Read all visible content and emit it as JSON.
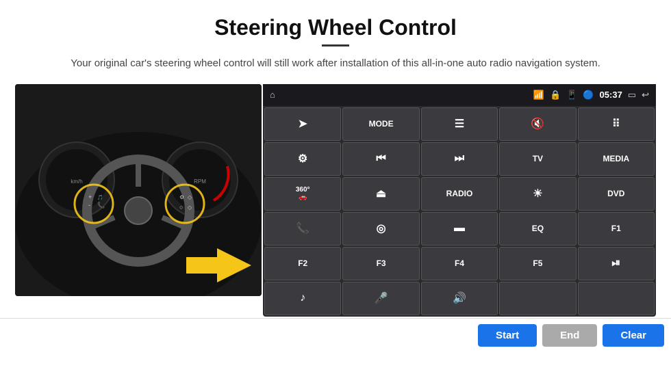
{
  "header": {
    "title": "Steering Wheel Control",
    "subtitle": "Your original car's steering wheel control will still work after installation of this all-in-one auto radio navigation system."
  },
  "status_bar": {
    "time": "05:37",
    "icons": [
      "wifi",
      "lock",
      "sim",
      "bluetooth",
      "screen",
      "back"
    ]
  },
  "grid": {
    "rows": [
      [
        {
          "label": "⌂",
          "type": "icon"
        },
        {
          "label": "MODE",
          "type": "text"
        },
        {
          "label": "≡",
          "type": "icon"
        },
        {
          "label": "🔇",
          "type": "icon"
        },
        {
          "label": "⠿",
          "type": "icon"
        }
      ],
      [
        {
          "label": "⊙",
          "type": "icon"
        },
        {
          "label": "⏮",
          "type": "icon"
        },
        {
          "label": "⏭",
          "type": "icon"
        },
        {
          "label": "TV",
          "type": "text"
        },
        {
          "label": "MEDIA",
          "type": "text"
        }
      ],
      [
        {
          "label": "360°",
          "type": "text"
        },
        {
          "label": "▲",
          "type": "icon"
        },
        {
          "label": "RADIO",
          "type": "text"
        },
        {
          "label": "☀",
          "type": "icon"
        },
        {
          "label": "DVD",
          "type": "text"
        }
      ],
      [
        {
          "label": "📞",
          "type": "icon"
        },
        {
          "label": "◉",
          "type": "icon"
        },
        {
          "label": "▬",
          "type": "icon"
        },
        {
          "label": "EQ",
          "type": "text"
        },
        {
          "label": "F1",
          "type": "text"
        }
      ],
      [
        {
          "label": "F2",
          "type": "text"
        },
        {
          "label": "F3",
          "type": "text"
        },
        {
          "label": "F4",
          "type": "text"
        },
        {
          "label": "F5",
          "type": "text"
        },
        {
          "label": "⏯",
          "type": "icon"
        }
      ],
      [
        {
          "label": "♪",
          "type": "icon"
        },
        {
          "label": "🎤",
          "type": "icon"
        },
        {
          "label": "🔊",
          "type": "icon"
        },
        {
          "label": "",
          "type": ""
        },
        {
          "label": "",
          "type": ""
        }
      ]
    ]
  },
  "bottom_buttons": {
    "start": "Start",
    "end": "End",
    "clear": "Clear"
  }
}
